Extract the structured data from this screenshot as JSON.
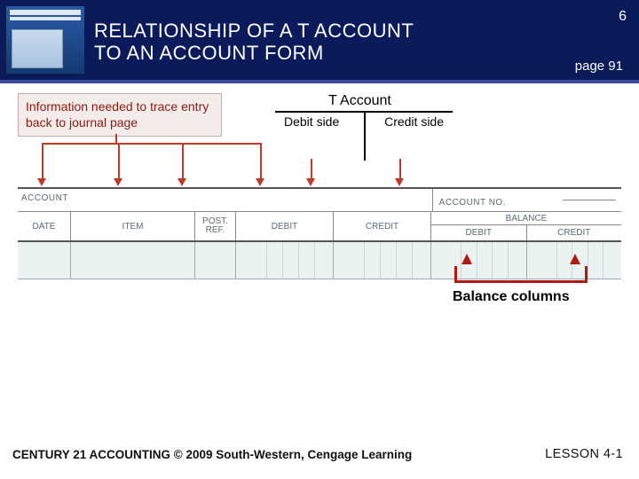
{
  "header": {
    "slide_number": "6",
    "title_line1": "RELATIONSHIP OF A T ACCOUNT",
    "title_line2": "TO AN ACCOUNT FORM",
    "page_ref": "page 91"
  },
  "diagram": {
    "callout_text": "Information needed to trace entry back to journal page",
    "t_account_label": "T Account",
    "debit_side": "Debit side",
    "credit_side": "Credit side"
  },
  "ledger": {
    "account_label": "ACCOUNT",
    "account_no_label": "ACCOUNT NO.",
    "columns": {
      "date": "DATE",
      "item": "ITEM",
      "post_ref_1": "POST.",
      "post_ref_2": "REF.",
      "debit": "DEBIT",
      "credit": "CREDIT",
      "balance": "BALANCE",
      "balance_debit": "DEBIT",
      "balance_credit": "CREDIT"
    }
  },
  "balance_columns_label": "Balance columns",
  "footer": {
    "left": "CENTURY 21 ACCOUNTING © 2009 South-Western, Cengage Learning",
    "right": "LESSON  4-1"
  }
}
